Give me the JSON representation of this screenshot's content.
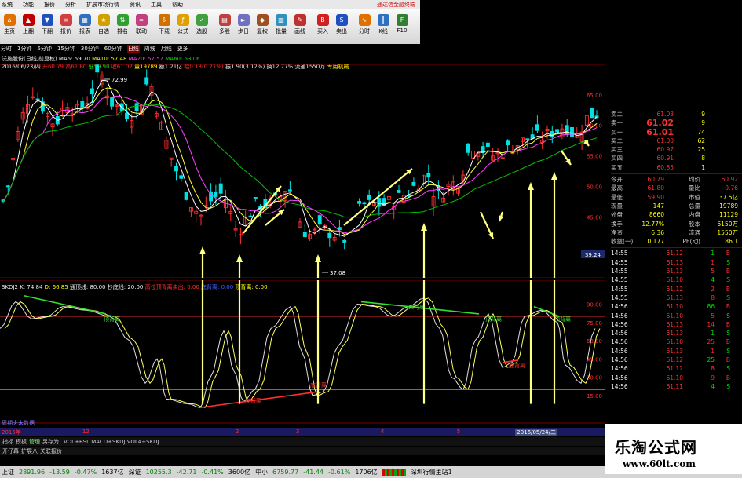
{
  "menu": {
    "items": [
      "系统",
      "功能",
      "报价",
      "分析",
      "扩展市场行情",
      "资讯",
      "工具",
      "帮助"
    ],
    "alert": "通达信金融终端"
  },
  "toolbar": [
    {
      "label": "主页",
      "icon": "home-icon",
      "color": "#e07000"
    },
    {
      "label": "上翻",
      "icon": "arrow-up-icon",
      "color": "#c00000"
    },
    {
      "label": "下翻",
      "icon": "arrow-down-icon",
      "color": "#2050c0"
    },
    {
      "label": "报价",
      "icon": "quote-icon",
      "color": "#d04040"
    },
    {
      "label": "报表",
      "icon": "table-icon",
      "color": "#3070c0"
    },
    {
      "label": "自选",
      "icon": "star-icon",
      "color": "#d0a000"
    },
    {
      "label": "排名",
      "icon": "rank-icon",
      "color": "#30a030"
    },
    {
      "label": "联动",
      "icon": "link-icon",
      "color": "#c04080"
    },
    {
      "label": "下载",
      "icon": "download-icon",
      "color": "#d07000"
    },
    {
      "label": "公式",
      "icon": "formula-icon",
      "color": "#e0a000"
    },
    {
      "label": "选股",
      "icon": "filter-icon",
      "color": "#40a040"
    },
    {
      "label": "多股",
      "icon": "grid-icon",
      "color": "#c04040"
    },
    {
      "label": "步日",
      "icon": "step-icon",
      "color": "#7070c0"
    },
    {
      "label": "复权",
      "icon": "adjust-icon",
      "color": "#a05020"
    },
    {
      "label": "批量",
      "icon": "batch-icon",
      "color": "#3090c0"
    },
    {
      "label": "画线",
      "icon": "pen-icon",
      "color": "#c03030"
    },
    {
      "label": "买入",
      "icon": "buy-icon",
      "color": "#d02020"
    },
    {
      "label": "卖出",
      "icon": "sell-icon",
      "color": "#2050c0"
    },
    {
      "label": "分时",
      "icon": "timeline-icon",
      "color": "#e07000"
    },
    {
      "label": "K线",
      "icon": "candle-icon",
      "color": "#3070c0"
    },
    {
      "label": "F10",
      "icon": "f10-icon",
      "color": "#308030"
    }
  ],
  "tabs": [
    "分时",
    "1分钟",
    "5分钟",
    "15分钟",
    "30分钟",
    "60分钟",
    "日线",
    "周线",
    "月线",
    "更多"
  ],
  "title_line": {
    "name": "沃施股份(日线,前复权)",
    "ma5": "MA5: 59.70",
    "ma10": "MA10: 57.48",
    "ma20": "MA20: 57.57",
    "ma60": "MA60: 53.06"
  },
  "info_line": {
    "date": "2016/06/23/四",
    "open": "开60.79",
    "high": "高61.80",
    "low": "低59.90",
    "close": "收61.02",
    "vol": "量19789",
    "pct": "额1.21亿",
    "chg": "幅0.13(0.21%)",
    "amp": "振1.90(3.12%)",
    "turn": "换12.77%",
    "flow": "流通1550万",
    "tag": "专用机械"
  },
  "annotations": {
    "high": "72.99",
    "low": "37.08",
    "current": "39.24",
    "sub_low1": "见底",
    "sub_low2": "见底"
  },
  "price_scale": [
    "65.00",
    "60.00",
    "55.00",
    "50.00",
    "45.00"
  ],
  "ind_scale": [
    "90.00",
    "75.00",
    "60.00",
    "45.00",
    "30.00",
    "15.00"
  ],
  "ind_line": {
    "name": "SKDJ2",
    "k": "K: 74.84",
    "d": "D: 66.85",
    "p1": "通顶线: 80.00",
    "p2": "抄底线: 20.00",
    "p3": "高位顶背离卖出: 0.00",
    "p4": "底背离: 0.00",
    "p5": "顶背离: 0.00"
  },
  "divergence_labels": {
    "top": "顶背离",
    "bottom": "底背离"
  },
  "time_axis": {
    "year": "2015年",
    "marks": [
      "12",
      "2",
      "3",
      "4",
      "5"
    ],
    "current_date": "2016/05/24/二"
  },
  "bottom": {
    "row1": [
      "指标",
      "模板",
      "管理",
      "另存为"
    ],
    "formula": "VOL+BSL MACD+SKDJ VOL4+SKDJ",
    "row2": [
      "开仔幕",
      "扩展八",
      "关联报价"
    ],
    "misc": "周期夫未数据"
  },
  "order_book": [
    {
      "l": "卖二",
      "v": "61.03",
      "n": "9",
      "c": "red"
    },
    {
      "l": "卖一",
      "v": "61.02",
      "n": "9",
      "c": "red"
    },
    {
      "l": "买一",
      "v": "61.01",
      "n": "74",
      "c": "red"
    },
    {
      "l": "买二",
      "v": "61.00",
      "n": "62",
      "c": "red"
    },
    {
      "l": "买三",
      "v": "60.97",
      "n": "25",
      "c": "red"
    },
    {
      "l": "买四",
      "v": "60.91",
      "n": "8",
      "c": "red"
    },
    {
      "l": "买五",
      "v": "60.85",
      "n": "1",
      "c": "red"
    }
  ],
  "stats": [
    {
      "a": "今开",
      "b": "60.79",
      "c": "均价",
      "d": "60.92"
    },
    {
      "a": "最高",
      "b": "61.80",
      "c": "量比",
      "d": "0.76"
    },
    {
      "a": "最低",
      "b": "59.90",
      "c": "市值",
      "d": "37.5亿"
    },
    {
      "a": "现量",
      "b": "147",
      "c": "总量",
      "d": "19789"
    },
    {
      "a": "外盘",
      "b": "8660",
      "c": "内盘",
      "d": "11129"
    },
    {
      "a": "换手",
      "b": "12.77%",
      "c": "股本",
      "d": "6150万"
    },
    {
      "a": "净资",
      "b": "6.36",
      "c": "流通",
      "d": "1550万"
    },
    {
      "a": "收益(一)",
      "b": "0.177",
      "c": "PE(动)",
      "d": "86.1"
    }
  ],
  "ticks": [
    {
      "t": "14:55",
      "p": "61.12",
      "v": "1"
    },
    {
      "t": "14:55",
      "p": "61.13",
      "v": "1"
    },
    {
      "t": "14:55",
      "p": "61.13",
      "v": "5"
    },
    {
      "t": "14:55",
      "p": "61.10",
      "v": "4"
    },
    {
      "t": "14:55",
      "p": "61.12",
      "v": "2"
    },
    {
      "t": "14:55",
      "p": "61.13",
      "v": "8"
    },
    {
      "t": "14:56",
      "p": "61.10",
      "v": "86"
    },
    {
      "t": "14:56",
      "p": "61.10",
      "v": "5"
    },
    {
      "t": "14:56",
      "p": "61.13",
      "v": "14"
    },
    {
      "t": "14:56",
      "p": "61.13",
      "v": "1"
    },
    {
      "t": "14:56",
      "p": "61.10",
      "v": "25"
    },
    {
      "t": "14:56",
      "p": "61.13",
      "v": "1"
    },
    {
      "t": "14:56",
      "p": "61.12",
      "v": "25"
    },
    {
      "t": "14:56",
      "p": "61.12",
      "v": "8"
    },
    {
      "t": "14:56",
      "p": "61.10",
      "v": "9"
    },
    {
      "t": "14:56",
      "p": "61.11",
      "v": "4"
    }
  ],
  "status": {
    "sh": "上证",
    "sh_v": "2891.96",
    "sh_c": "-13.59",
    "sh_p": "-0.47%",
    "sh_a": "1637亿",
    "sz": "深证",
    "sz_v": "10255.3",
    "sz_c": "-42.71",
    "sz_p": "-0.41%",
    "sz_a": "3600亿",
    "zx": "中小",
    "zx_v": "6759.77",
    "zx_c": "-41.44",
    "zx_p": "-0.61%",
    "zx_a": "1706亿",
    "conn": "深圳行情主站1"
  },
  "watermark": {
    "title": "乐淘公式网",
    "url": "www.60lt.com"
  }
}
